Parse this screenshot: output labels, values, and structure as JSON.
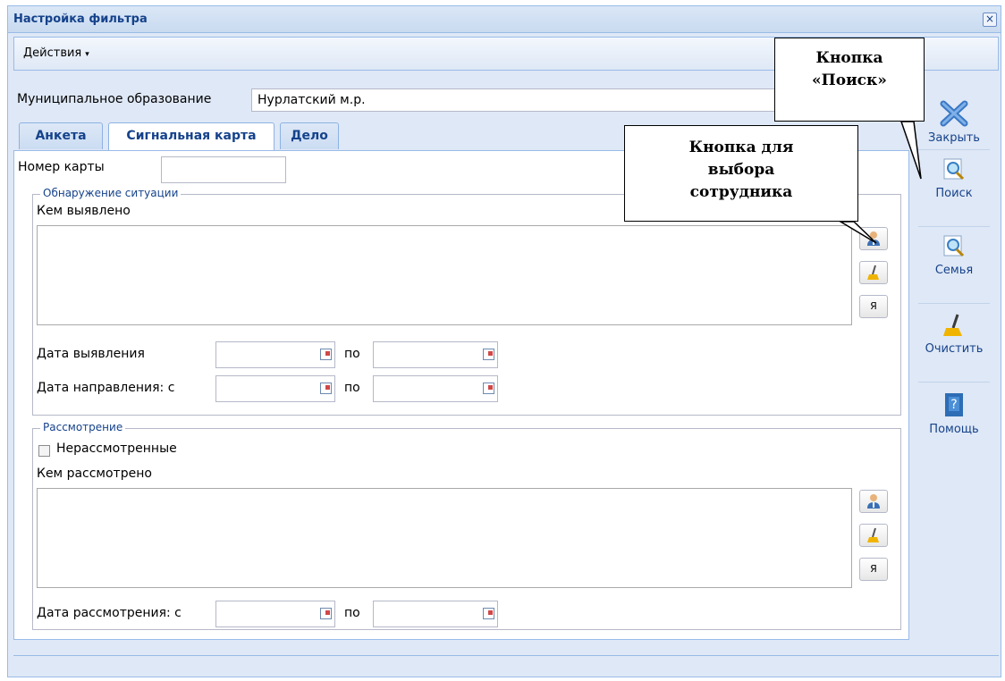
{
  "window": {
    "title": "Настройка фильтра",
    "close_glyph": "×"
  },
  "toolbar": {
    "actions_label": "Действия",
    "actions_caret": "▾"
  },
  "muni": {
    "label": "Муниципальное образование",
    "value": "Нурлатский м.р."
  },
  "tabs": [
    {
      "label": "Анкета"
    },
    {
      "label": "Сигнальная карта",
      "active": true
    },
    {
      "label": "Дело"
    }
  ],
  "card": {
    "label": "Номер карты",
    "value": ""
  },
  "detection": {
    "legend": "Обнаружение ситуации",
    "by_label": "Кем выявлено",
    "date_label": "Дата выявления",
    "direction_label": "Дата направления: с",
    "to_label": "по",
    "me_label": "Я"
  },
  "review": {
    "legend": "Рассмотрение",
    "unreviewed_label": "Нерассмотренные",
    "by_label": "Кем рассмотрено",
    "date_label": "Дата рассмотрения: с",
    "to_label": "по",
    "me_label": "Я"
  },
  "sidebar": {
    "items": [
      {
        "label": "Закрыть",
        "icon": "close-x-icon"
      },
      {
        "label": "Поиск",
        "icon": "search-icon"
      },
      {
        "label": "Семья",
        "icon": "search-icon"
      },
      {
        "label": "Очистить",
        "icon": "broom-icon"
      },
      {
        "label": "Помощь",
        "icon": "help-book-icon"
      }
    ]
  },
  "callouts": {
    "search_line1": "Кнопка",
    "search_line2": "«Поиск»",
    "select_line1": "Кнопка для",
    "select_line2": "выбора",
    "select_line3": "сотрудника"
  },
  "colors": {
    "accent": "#15428b",
    "panel_bg": "#dfe8f6",
    "border": "#99bbe8"
  }
}
